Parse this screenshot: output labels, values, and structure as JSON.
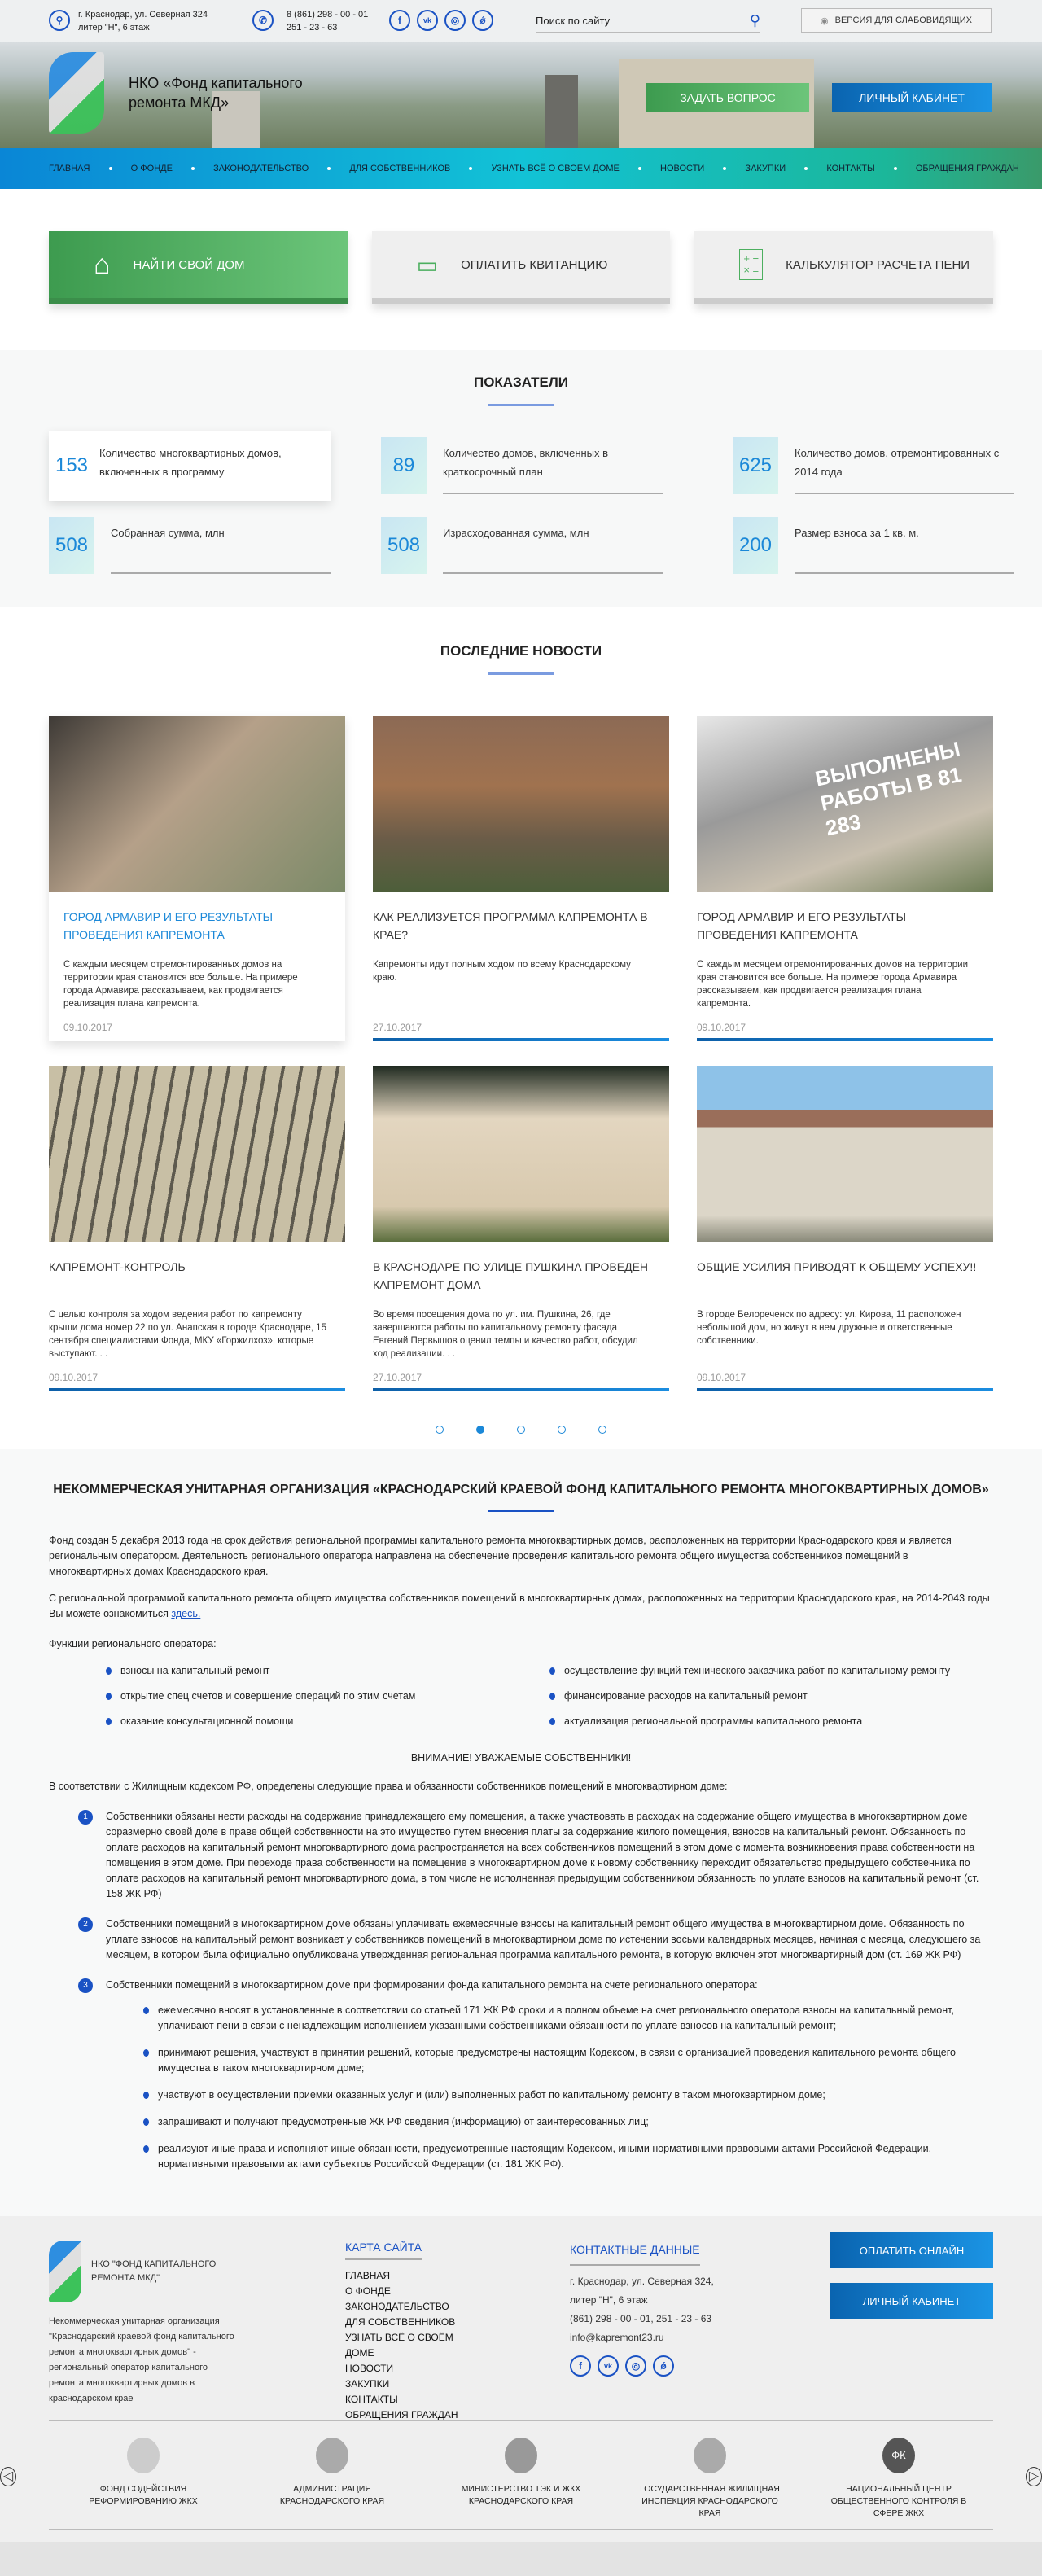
{
  "topbar": {
    "address": "г. Краснодар, ул. Северная 324",
    "address2": "литер \"Н\", 6 этаж",
    "phone1": "8 (861) 298 - 00 - 01",
    "phone2": "251 - 23 - 63",
    "social": [
      "f",
      "vk",
      "ig",
      "ok"
    ],
    "search_placeholder": "Поиск по сайту",
    "accessibility": "ВЕРСИЯ ДЛЯ СЛАБОВИДЯЩИХ"
  },
  "hero": {
    "org_name": "НКО «Фонд капитального ремонта МКД»",
    "ask_button": "ЗАДАТЬ ВОПРОС",
    "cabinet_button": "ЛИЧНЫЙ КАБИНЕТ"
  },
  "nav": [
    "ГЛАВНАЯ",
    "О ФОНДЕ",
    "ЗАКОНОДАТЕЛЬСТВО",
    "ДЛЯ СОБСТВЕННИКОВ",
    "УЗНАТЬ ВСЁ О СВОЕМ ДОМЕ",
    "НОВОСТИ",
    "ЗАКУПКИ",
    "КОНТАКТЫ",
    "ОБРАЩЕНИЯ ГРАЖДАН"
  ],
  "quick": [
    {
      "label": "НАЙТИ СВОЙ ДОМ",
      "icon": "house-icon"
    },
    {
      "label": "ОПЛАТИТЬ КВИТАНЦИЮ",
      "icon": "wallet-icon"
    },
    {
      "label": "КАЛЬКУЛЯТОР РАСЧЕТА ПЕНИ",
      "icon": "calculator-icon"
    }
  ],
  "stats": {
    "title": "ПОКАЗАТЕЛИ",
    "items": [
      {
        "value": "153",
        "label": "Количество многоквартирных домов, включенных в программу"
      },
      {
        "value": "89",
        "label": "Количество домов, включенных в краткосрочный план"
      },
      {
        "value": "625",
        "label": "Количество домов, отремонтированных с 2014 года"
      },
      {
        "value": "508",
        "label": "Собранная сумма, млн"
      },
      {
        "value": "508",
        "label": "Израсходованная сумма, млн"
      },
      {
        "value": "200",
        "label": "Размер взноса за 1 кв. м."
      }
    ]
  },
  "news": {
    "title": "ПОСЛЕДНИЕ НОВОСТИ",
    "items": [
      {
        "title": "ГОРОД АРМАВИР И ЕГО РЕЗУЛЬТАТЫ ПРОВЕДЕНИЯ КАПРЕМОНТА",
        "text": "С каждым месяцем отремонтированных домов на территории края становится все больше. На примере города Армавира рассказываем, как продвигается реализация плана капремонта.",
        "date": "09.10.2017"
      },
      {
        "title": "КАК РЕАЛИЗУЕТСЯ ПРОГРАММА КАПРЕМОНТА В КРАЕ?",
        "text": "Капремонты идут полным ходом по всему Краснодарскому краю.",
        "date": "27.10.2017"
      },
      {
        "title": "ГОРОД АРМАВИР И ЕГО РЕЗУЛЬТАТЫ ПРОВЕДЕНИЯ КАПРЕМОНТА",
        "text": "С каждым месяцем отремонтированных домов на территории края становится все больше. На примере города Армавира рассказываем, как продвигается реализация плана капремонта.",
        "date": "09.10.2017"
      },
      {
        "title": "КАПРЕМОНТ-КОНТРОЛЬ",
        "text": "С целью контроля за ходом ведения работ по капремонту крыши дома номер 22 по ул. Анапская в городе Краснодаре, 15 сентября специалистами Фонда, МКУ «Горжилхоз», которые выступают. . .",
        "date": "09.10.2017"
      },
      {
        "title": "В КРАСНОДАРЕ ПО УЛИЦЕ ПУШКИНА ПРОВЕДЕН КАПРЕМОНТ ДОМА",
        "text": "Во время посещения дома по ул. им. Пушкина, 26, где завершаются работы по капитальному ремонту фасада Евгений Первышов оценил темпы и качество работ, обсудил ход реализации. . .",
        "date": "27.10.2017"
      },
      {
        "title": "ОБЩИЕ УСИЛИЯ ПРИВОДЯТ К ОБЩЕМУ УСПЕХУ!!",
        "text": "В городе Белореченск по адресу: ул. Кирова, 11 расположен небольшой дом, но живут в нем дружные и ответственные собственники.",
        "date": "09.10.2017"
      }
    ],
    "image_caption": "ВЫПОЛНЕНЫ РАБОТЫ В 81 283",
    "pages": 5,
    "current_page": 2
  },
  "about": {
    "title": "НЕКОММЕРЧЕСКАЯ УНИТАРНАЯ ОРГАНИЗАЦИЯ «КРАСНОДАРСКИЙ КРАЕВОЙ ФОНД КАПИТАЛЬНОГО РЕМОНТА МНОГОКВАРТИРНЫХ ДОМОВ»",
    "p1": "Фонд создан 5 декабря 2013 года на срок действия региональной программы капитального ремонта многоквартирных домов, расположенных на территории Краснодарского края и является региональным оператором. Деятельность регионального оператора направлена на обеспечение проведения капитального ремонта общего имущества собственников помещений в многоквартирных домах Краснодарского края.",
    "p2": "С региональной программой капитального ремонта общего имущества собственников помещений в многоквартирных домах, расположенных на территории Краснодарского края, на 2014-2043 годы Вы можете ознакомиться ",
    "p2_link": "здесь.",
    "functions_title": "Функции регионального оператора:",
    "functions": [
      "взносы на капитальный ремонт",
      "осуществление функций технического заказчика работ по капитальному ремонту",
      "открытие спец счетов и совершение операций по этим счетам",
      "финансирование расходов на капитальный ремонт",
      "оказание консультационной помощи",
      "актуализация региональной программы капитального ремонта"
    ],
    "attention": "ВНИМАНИЕ! УВАЖАЕМЫЕ СОБСТВЕННИКИ!",
    "intro": "В соответствии с Жилищным кодексом РФ, определены следующие права и обязанности собственников помещений в многоквартирном доме:",
    "rules": [
      {
        "n": "1",
        "text": "Собственники обязаны нести расходы на содержание принадлежащего ему помещения, а также участвовать в расходах на содержание общего имущества в многоквартирном доме соразмерно своей доле в праве общей собственности на это имущество путем внесения платы за содержание жилого помещения, взносов на капитальный ремонт. Обязанность по оплате расходов на капитальный ремонт многоквартирного дома распространяется на всех собственников помещений в этом доме с момента возникновения права собственности на помещения в этом доме. При переходе права собственности на помещение в многоквартирном доме к новому собственнику переходит обязательство предыдущего собственника по оплате расходов на капитальный ремонт многоквартирного дома, в том числе не исполненная предыдущим собственником обязанность по уплате взносов на капитальный ремонт (ст. 158 ЖК РФ)"
      },
      {
        "n": "2",
        "text": "Собственники помещений в многоквартирном доме обязаны уплачивать ежемесячные взносы на капитальный ремонт общего имущества в многоквартирном доме. Обязанность по уплате взносов на капитальный ремонт возникает у собственников помещений в многоквартирном доме по истечении восьми календарных месяцев, начиная с месяца, следующего за месяцем, в котором была официально опубликована утвержденная региональная программа капитального ремонта, в которую включен этот многоквартирный дом (ст. 169 ЖК РФ)"
      },
      {
        "n": "3",
        "text": "Собственники помещений в многоквартирном доме при формировании фонда капитального ремонта на счете регионального оператора:"
      }
    ],
    "subrules": [
      "ежемесячно вносят в установленные в соответствии со статьей 171 ЖК РФ сроки и в полном объеме на счет регионального оператора взносы на капитальный ремонт, уплачивают пени в связи с ненадлежащим исполнением указанными собственниками обязанности по уплате взносов на капитальный ремонт;",
      "принимают решения, участвуют в принятии решений, которые предусмотрены настоящим Кодексом, в связи с организацией проведения капитального ремонта общего имущества в таком многоквартирном доме;",
      "участвуют в осуществлении приемки оказанных услуг и (или) выполненных работ по капитальному ремонту в таком многоквартирном доме;",
      "запрашивают и получают предусмотренные ЖК РФ сведения (информацию) от заинтересованных лиц;",
      "реализуют иные права и исполняют иные обязанности, предусмотренные настоящим Кодексом, иными нормативными правовыми актами Российской Федерации, нормативными правовыми актами субъектов Российской Федерации (ст. 181 ЖК РФ)."
    ]
  },
  "footer": {
    "org_name": "НКО \"ФОНД КАПИТАЛЬНОГО РЕМОНТА МКД\"",
    "org_desc": "Некоммерческая унитарная организация \"Краснодарский краевой фонд капитального ремонта многоквартирных домов\" - региональный оператор капитального ремонта многоквартирных домов в краснодарском крае",
    "sitemap_title": "КАРТА САЙТА",
    "sitemap": [
      "ГЛАВНАЯ",
      "О ФОНДЕ",
      "ЗАКОНОДАТЕЛЬСТВО",
      "ДЛЯ СОБСТВЕННИКОВ",
      "УЗНАТЬ ВСЁ О СВОЁМ ДОМЕ",
      "НОВОСТИ",
      "ЗАКУПКИ",
      "КОНТАКТЫ",
      "ОБРАЩЕНИЯ ГРАЖДАН"
    ],
    "contacts_title": "КОНТАКТНЫЕ ДАННЫЕ",
    "address": "г. Краснодар, ул. Северная 324,",
    "address2": "литер \"Н\", 6 этаж",
    "phones": "(861) 298 - 00 - 01, 251 - 23 - 63",
    "email": "info@kapremont23.ru",
    "pay_button": "ОПЛАТИТЬ ОНЛАЙН",
    "cabinet_button": "ЛИЧНЫЙ КАБИНЕТ",
    "partners": [
      "ФОНД СОДЕЙСТВИЯ РЕФОРМИРОВАНИЮ ЖКХ",
      "АДМИНИСТРАЦИЯ КРАСНОДАРСКОГО КРАЯ",
      "МИНИСТЕРСТВО ТЭК И ЖКХ КРАСНОДАРСКОГО КРАЯ",
      "ГОСУДАРСТВЕННАЯ ЖИЛИЩНАЯ ИНСПЕКЦИЯ КРАСНОДАРСКОГО КРАЯ",
      "НАЦИОНАЛЬНЫЙ ЦЕНТР ОБЩЕСТВЕННОГО КОНТРОЛЯ В СФЕРЕ ЖКХ"
    ],
    "partner_logo_text": "ФК"
  },
  "colors": {
    "accent": "#1a52c4",
    "green": "#4caf5f",
    "blue": "#1b88d8"
  }
}
